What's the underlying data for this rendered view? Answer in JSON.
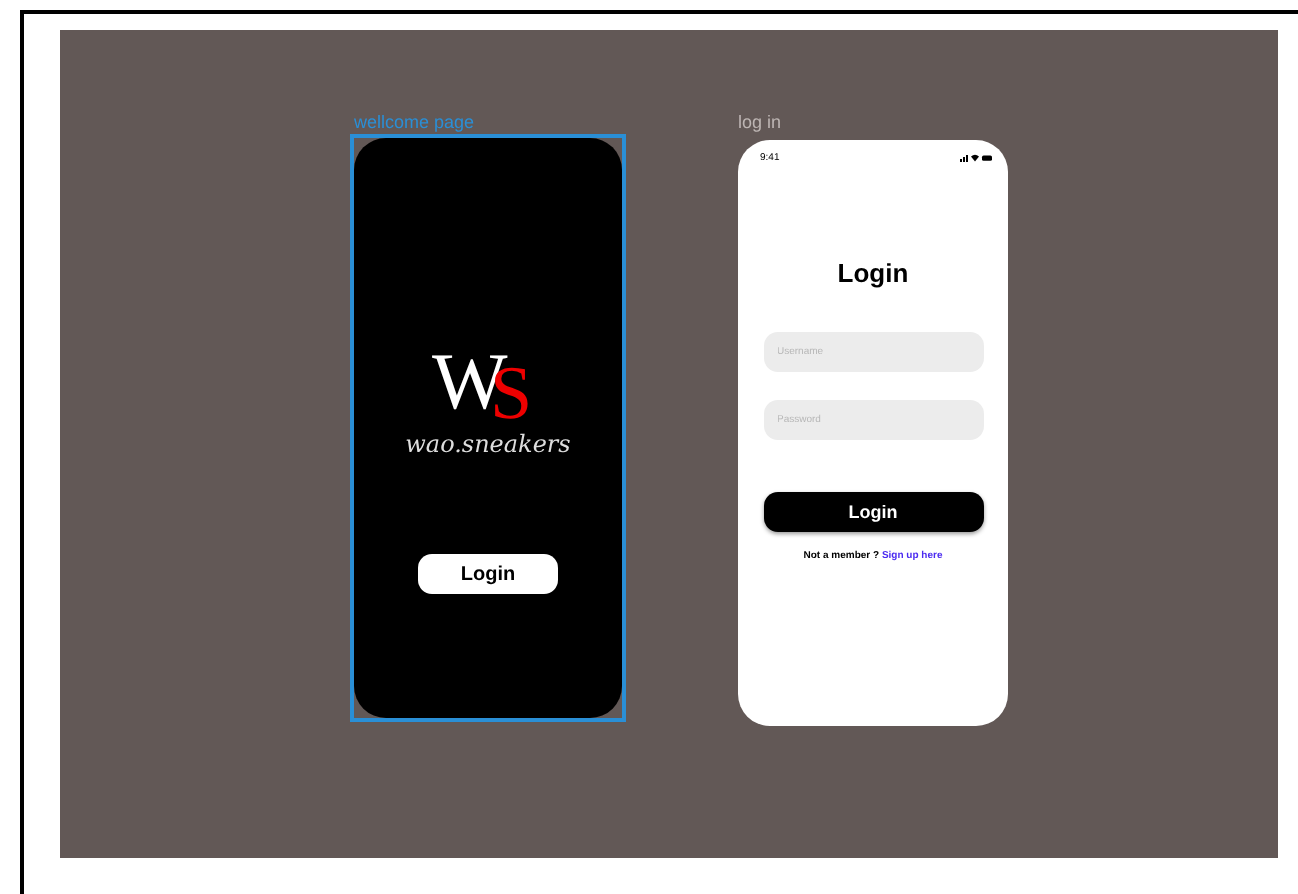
{
  "frames": [
    {
      "kind": "welcome",
      "label": "wellcome page",
      "selected": true,
      "logo": {
        "first": "W",
        "second": "S"
      },
      "brand": "wao.sneakers",
      "button": "Login"
    },
    {
      "kind": "login",
      "label": "log in",
      "selected": false,
      "status_time": "9:41",
      "title": "Login",
      "fields": [
        {
          "placeholder": "Username"
        },
        {
          "placeholder": "Password"
        }
      ],
      "button": "Login",
      "footer": "Not a member ?",
      "link": "Sign up here"
    }
  ]
}
